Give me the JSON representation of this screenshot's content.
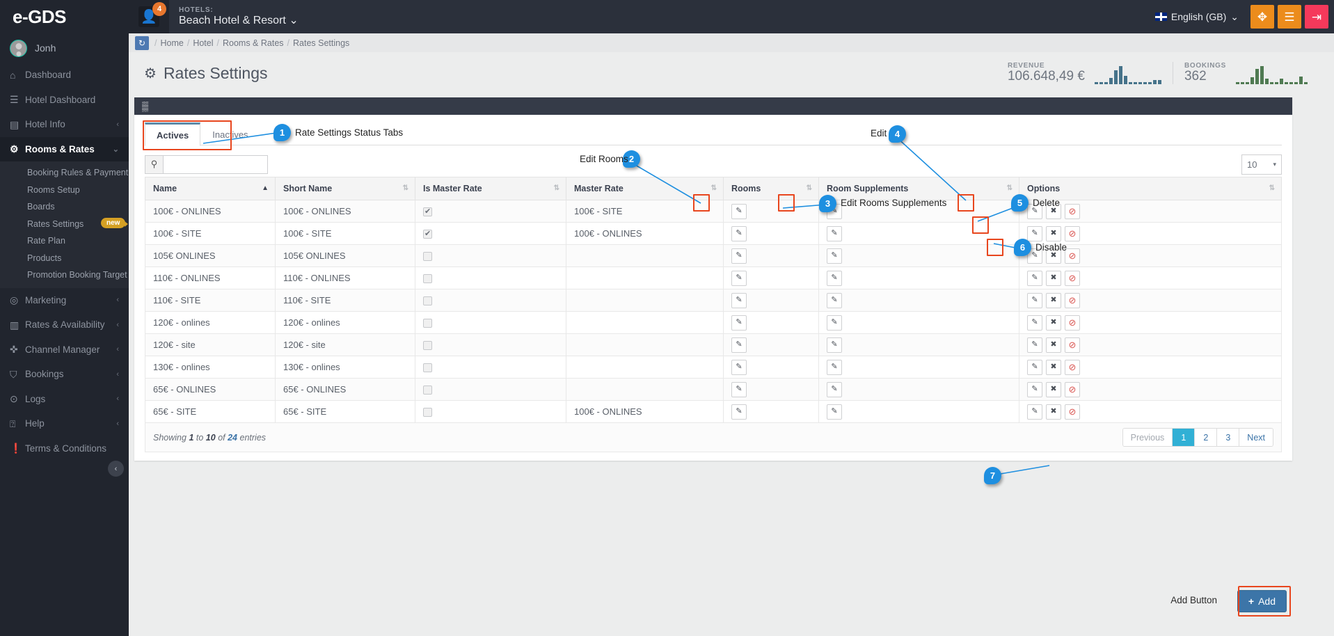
{
  "topbar": {
    "logo": "e-GDS",
    "notification_count": "4",
    "hotels_label": "HOTELS:",
    "hotel_name": "Beach Hotel & Resort",
    "hotel_caret": "⌄",
    "language": "English (GB)",
    "lang_caret": "⌄",
    "buttons": [
      {
        "name": "fullscreen-button",
        "glyph": "✥",
        "color": "#ec8c1c"
      },
      {
        "name": "menu-button",
        "glyph": "☰",
        "color": "#ec8c1c"
      },
      {
        "name": "logout-button",
        "glyph": "⇥",
        "color": "#f5395b"
      }
    ]
  },
  "sidebar": {
    "user": "Jonh",
    "items": [
      {
        "label": "Dashboard",
        "icon": "home-icon",
        "glyph": "⌂",
        "chevron": ""
      },
      {
        "label": "Hotel Dashboard",
        "icon": "list-icon",
        "glyph": "☰",
        "chevron": ""
      },
      {
        "label": "Hotel Info",
        "icon": "building-icon",
        "glyph": "▤",
        "chevron": "‹"
      },
      {
        "label": "Rooms & Rates",
        "icon": "gears-icon",
        "glyph": "⚙",
        "chevron": "⌄",
        "active": true
      }
    ],
    "sub_items": [
      {
        "label": "Booking Rules & Payment"
      },
      {
        "label": "Rooms Setup"
      },
      {
        "label": "Boards"
      },
      {
        "label": "Rates Settings",
        "badge": "new"
      },
      {
        "label": "Rate Plan"
      },
      {
        "label": "Products"
      },
      {
        "label": "Promotion Booking Target"
      }
    ],
    "items_bottom": [
      {
        "label": "Marketing",
        "icon": "target-icon",
        "glyph": "◎",
        "chevron": "‹"
      },
      {
        "label": "Rates & Availability",
        "icon": "chart-bar-icon",
        "glyph": "▥",
        "chevron": "‹"
      },
      {
        "label": "Channel Manager",
        "icon": "arrows-icon",
        "glyph": "✜",
        "chevron": "‹"
      },
      {
        "label": "Bookings",
        "icon": "cart-icon",
        "glyph": "⛉",
        "chevron": "‹"
      },
      {
        "label": "Logs",
        "icon": "clock-icon",
        "glyph": "⊙",
        "chevron": "‹"
      },
      {
        "label": "Help",
        "icon": "question-circle-icon",
        "glyph": "⍰",
        "chevron": "‹"
      },
      {
        "label": "Terms & Conditions",
        "icon": "exclamation-circle-icon",
        "glyph": "❗",
        "chevron": ""
      }
    ],
    "collapse_glyph": "‹"
  },
  "breadcrumb": {
    "refresh_glyph": "↻",
    "items": [
      "Home",
      "Hotel",
      "Rooms & Rates",
      "Rates Settings"
    ],
    "separator": "/"
  },
  "page": {
    "title": "Rates Settings",
    "title_icon_glyph": "⚙"
  },
  "stats": [
    {
      "label": "REVENUE",
      "value": "106.648,49 €",
      "color": "#46738a",
      "spark": [
        3,
        3,
        3,
        9,
        20,
        26,
        12,
        3,
        3,
        3,
        3,
        3,
        6,
        6
      ]
    },
    {
      "label": "BOOKINGS",
      "value": "362",
      "color": "#4f7a52",
      "spark": [
        3,
        3,
        3,
        10,
        22,
        26,
        8,
        3,
        3,
        8,
        3,
        3,
        3,
        11,
        3
      ]
    }
  ],
  "panel": {
    "grid_icon_glyph": "▒",
    "tabs": [
      {
        "label": "Actives",
        "active": true
      },
      {
        "label": "Inactives",
        "active": false
      }
    ],
    "search_placeholder": "",
    "search_value": "",
    "search_icon_glyph": "⚲",
    "page_length": "10",
    "page_length_caret": "▾"
  },
  "table": {
    "columns": [
      {
        "label": "Name",
        "sort": "asc"
      },
      {
        "label": "Short Name",
        "sort": "none"
      },
      {
        "label": "Is Master Rate",
        "sort": "none"
      },
      {
        "label": "Master Rate",
        "sort": "none"
      },
      {
        "label": "Rooms",
        "sort": "none"
      },
      {
        "label": "Room Supplements",
        "sort": "none"
      },
      {
        "label": "Options",
        "sort": "none"
      }
    ],
    "sort_asc_glyph": "▲",
    "sort_none_glyph": "⇅",
    "edit_glyph": "✎",
    "delete_glyph": "✖",
    "disable_glyph": "⊘",
    "rows": [
      {
        "name": "100€ - ONLINES",
        "short_name": "100€ - ONLINES",
        "is_master": true,
        "master_rate": "100€ - SITE"
      },
      {
        "name": "100€ - SITE",
        "short_name": "100€ - SITE",
        "is_master": true,
        "master_rate": "100€ - ONLINES"
      },
      {
        "name": "105€ ONLINES",
        "short_name": "105€ ONLINES",
        "is_master": false,
        "master_rate": ""
      },
      {
        "name": "110€ - ONLINES",
        "short_name": "110€ - ONLINES",
        "is_master": false,
        "master_rate": ""
      },
      {
        "name": "110€ - SITE",
        "short_name": "110€ - SITE",
        "is_master": false,
        "master_rate": ""
      },
      {
        "name": "120€ - onlines",
        "short_name": "120€ - onlines",
        "is_master": false,
        "master_rate": ""
      },
      {
        "name": "120€ - site",
        "short_name": "120€ - site",
        "is_master": false,
        "master_rate": ""
      },
      {
        "name": "130€ - onlines",
        "short_name": "130€ - onlines",
        "is_master": false,
        "master_rate": ""
      },
      {
        "name": "65€ - ONLINES",
        "short_name": "65€ - ONLINES",
        "is_master": false,
        "master_rate": ""
      },
      {
        "name": "65€ - SITE",
        "short_name": "65€ - SITE",
        "is_master": false,
        "master_rate": "100€ - ONLINES"
      }
    ]
  },
  "footer": {
    "showing_prefix": "Showing",
    "showing_from": "1",
    "showing_to_word": "to",
    "showing_to": "10",
    "showing_of_word": "of",
    "showing_total": "24",
    "showing_suffix": "entries",
    "pager": [
      {
        "label": "Previous",
        "state": "muted"
      },
      {
        "label": "1",
        "state": "current"
      },
      {
        "label": "2",
        "state": "normal"
      },
      {
        "label": "3",
        "state": "normal"
      },
      {
        "label": "Next",
        "state": "normal"
      }
    ]
  },
  "add": {
    "label": "Add Button",
    "button_text": "Add",
    "button_icon": "+"
  },
  "annotations": [
    {
      "num": "1",
      "label": "Rate Settings Status Tabs"
    },
    {
      "num": "2",
      "label": "Edit Rooms"
    },
    {
      "num": "3",
      "label": "Edit Rooms Supplements"
    },
    {
      "num": "4",
      "label": "Edit"
    },
    {
      "num": "5",
      "label": "Delete"
    },
    {
      "num": "6",
      "label": "Disable"
    },
    {
      "num": "7",
      "label": "Add Button"
    }
  ],
  "colors": {
    "accent_blue": "#1e8fe0",
    "highlight_red": "#e8461e",
    "topbar_dark": "#2b303b",
    "sidebar_dark": "#21252e",
    "add_button": "#3c75a8",
    "pager_current": "#31b0d5",
    "badge_orange": "#e8772e",
    "badge_new": "#d5a024"
  }
}
